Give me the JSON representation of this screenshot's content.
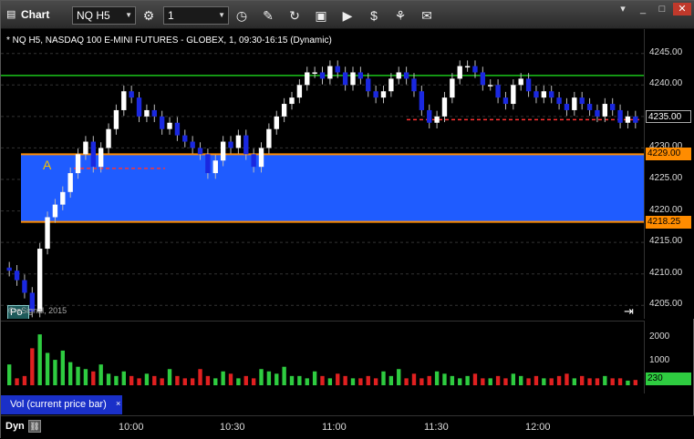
{
  "toolbar": {
    "title": "Chart",
    "symbol": "NQ H5",
    "interval": "1"
  },
  "chart": {
    "header": "* NQ H5, NASDAQ 100 E-MINI FUTURES - GLOBEX, 1, 09:30-16:15 (Dynamic)",
    "copyright": "© eSignal, 2015",
    "price_labels": [
      "4245.00",
      "4240.00",
      "4235.00",
      "4230.00",
      "4225.00",
      "4220.00",
      "4215.00",
      "4210.00",
      "4205.00"
    ],
    "current_price": "4235.00",
    "upper_level": "4229.00",
    "lower_level": "4218.25",
    "annotation_a": "A",
    "po_label": "Po",
    "x_labels": [
      "10:00",
      "10:30",
      "11:00",
      "11:30",
      "12:00"
    ],
    "dyn_label": "Dyn"
  },
  "volume": {
    "label": "Vol (current price bar)",
    "close_glyph": "×",
    "axis_labels": [
      "2000",
      "1000",
      "0"
    ],
    "current_value": "230"
  },
  "colors": {
    "zone": "#1f5cff",
    "up_candle": "#ffffff",
    "down_candle": "#1a28e0",
    "level_line": "#ff8c00",
    "resistance": "#19c419",
    "dash_line": "#ff3333"
  },
  "chart_data": {
    "type": "candlestick",
    "y_range": [
      4202,
      4248
    ],
    "upper_level": 4229.0,
    "lower_level": 4218.25,
    "green_line": 4241.5,
    "red_dash_levels": [
      4226.75,
      4234.5
    ],
    "closes": [
      4210.5,
      4209,
      4207,
      4204,
      4214,
      4219,
      4221,
      4223,
      4226,
      4229,
      4231,
      4227,
      4230,
      4233,
      4236,
      4239,
      4238,
      4235,
      4236,
      4235,
      4233,
      4234,
      4232,
      4231,
      4230,
      4229,
      4226,
      4228,
      4231,
      4230,
      4232,
      4229,
      4227,
      4230,
      4233,
      4235,
      4237,
      4238,
      4240,
      4242,
      4242,
      4241,
      4243,
      4242,
      4240,
      4242,
      4241,
      4239,
      4238,
      4239,
      4241,
      4242,
      4241,
      4239,
      4236,
      4234,
      4235,
      4238,
      4241,
      4243,
      4243,
      4242,
      4240,
      4240,
      4238,
      4237,
      4240,
      4241,
      4239,
      4238,
      4239,
      4238,
      4237,
      4236,
      4238,
      4237,
      4236,
      4235,
      4237,
      4236,
      4234,
      4235,
      4234
    ],
    "volumes": [
      900,
      300,
      400,
      1600,
      2200,
      1400,
      1100,
      1500,
      1000,
      800,
      700,
      600,
      900,
      500,
      400,
      600,
      400,
      300,
      500,
      400,
      300,
      700,
      400,
      300,
      300,
      700,
      400,
      300,
      600,
      500,
      300,
      400,
      300,
      700,
      600,
      500,
      800,
      400,
      400,
      300,
      600,
      400,
      300,
      500,
      400,
      300,
      300,
      400,
      300,
      600,
      400,
      700,
      300,
      500,
      300,
      400,
      600,
      500,
      400,
      300,
      400,
      500,
      300,
      300,
      400,
      300,
      500,
      400,
      300,
      400,
      300,
      300,
      400,
      500,
      300,
      400,
      300,
      300,
      400,
      300,
      300,
      200,
      230
    ]
  }
}
